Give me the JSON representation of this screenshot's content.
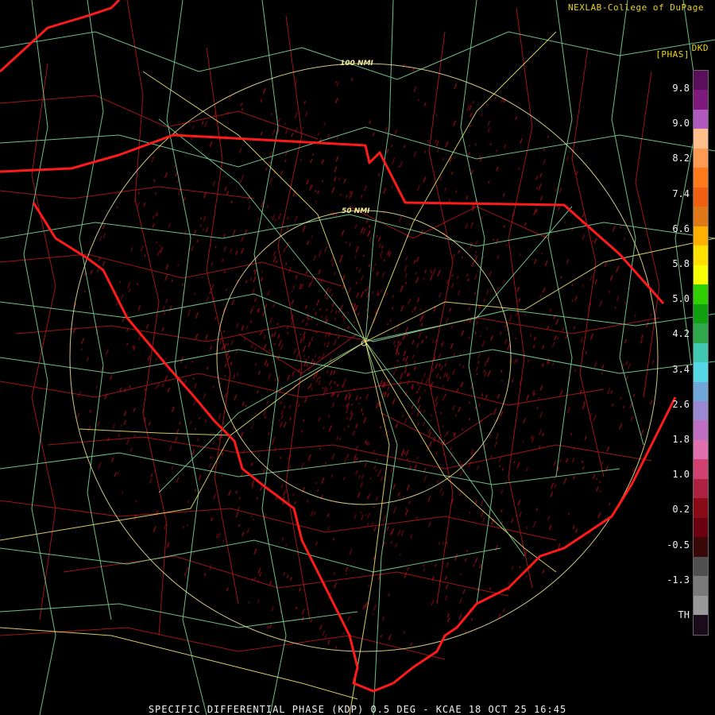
{
  "header": {
    "credit": "NEXLAB-College of DuPage",
    "station_tag": "DKD",
    "units": "[PHAS]"
  },
  "rings": [
    {
      "label": "100 NMI"
    },
    {
      "label": "50 NMI"
    }
  ],
  "legend": {
    "ticks": [
      "9.8",
      "9.0",
      "8.2",
      "7.4",
      "6.6",
      "5.8",
      "5.0",
      "4.2",
      "3.4",
      "2.6",
      "1.8",
      "1.0",
      "0.2",
      "-0.5",
      "-1.3",
      "TH"
    ],
    "colors": [
      "#5a0f5a",
      "#7e1a7e",
      "#b05abf",
      "#ffbe8a",
      "#ff9a52",
      "#ff7a1a",
      "#f06010",
      "#e07818",
      "#ffb000",
      "#ffe000",
      "#f5ff00",
      "#30d000",
      "#10a010",
      "#2ea84a",
      "#40c8b0",
      "#55d8e6",
      "#6fa8d8",
      "#9a88d0",
      "#c070c0",
      "#e070b0",
      "#d04070",
      "#b02040",
      "#8a0a18",
      "#6a0010",
      "#3a0808",
      "#505050",
      "#7a7a7a",
      "#999999",
      "#1a0a1a"
    ]
  },
  "footer": {
    "title": "SPECIFIC DIFFERENTIAL PHASE (KDP) 0.5 DEG - KCAE 18 OCT 25 16:45"
  }
}
